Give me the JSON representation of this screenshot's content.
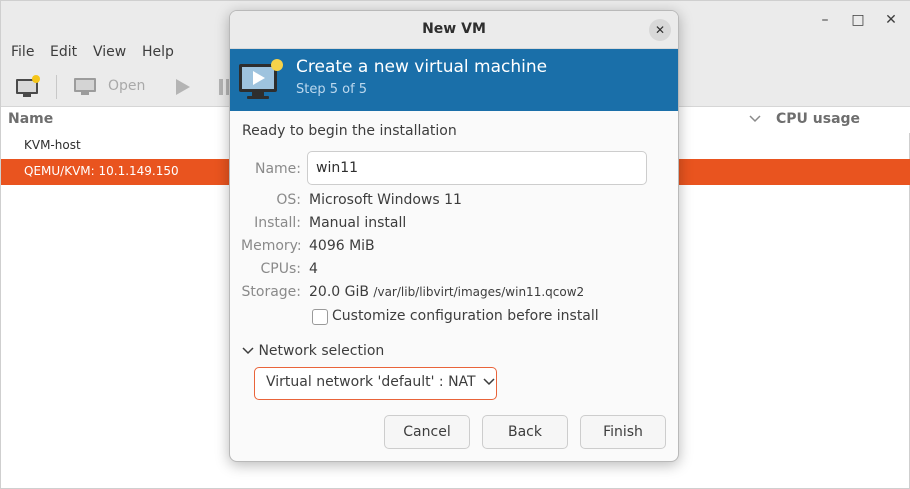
{
  "main_window": {
    "window_controls": {
      "minimize": "–",
      "maximize": "□",
      "close": "✕"
    },
    "menu": [
      "File",
      "Edit",
      "View",
      "Help"
    ],
    "toolbar": {
      "new_vm_icon": "computer-plus-icon",
      "open_icon": "monitor-icon",
      "open_label": "Open",
      "run_icon": "play-icon",
      "pause_icon": "pause-icon"
    },
    "columns": {
      "name": "Name",
      "cpu": "CPU usage"
    },
    "connections": [
      {
        "label": "KVM-host",
        "selected": false
      },
      {
        "label": "QEMU/KVM: 10.1.149.150",
        "selected": true
      }
    ],
    "colors": {
      "selection": "#e9541f",
      "chrome": "#ebebeb"
    }
  },
  "dialog": {
    "title": "New VM",
    "close_icon": "close-icon",
    "banner": {
      "icon": "computer-star-icon",
      "title": "Create a new virtual machine",
      "step": "Step 5 of 5",
      "color": "#1a6fa9"
    },
    "ready_text": "Ready to begin the installation",
    "fields": {
      "name_label": "Name:",
      "name_value": "win11",
      "os_label": "OS:",
      "os_value": "Microsoft Windows 11",
      "install_label": "Install:",
      "install_value": "Manual install",
      "memory_label": "Memory:",
      "memory_value": "4096 MiB",
      "cpus_label": "CPUs:",
      "cpus_value": "4",
      "storage_label": "Storage:",
      "storage_size": "20.0 GiB",
      "storage_path": "/var/lib/libvirt/images/win11.qcow2"
    },
    "customize": {
      "label": "Customize configuration before install",
      "checked": false
    },
    "network": {
      "expander_label": "Network selection",
      "expander_icon": "chevron-down-icon",
      "selected": "Virtual network 'default' : NAT",
      "dropdown_icon": "chevron-down-icon"
    },
    "buttons": {
      "cancel": "Cancel",
      "back": "Back",
      "finish": "Finish"
    }
  }
}
